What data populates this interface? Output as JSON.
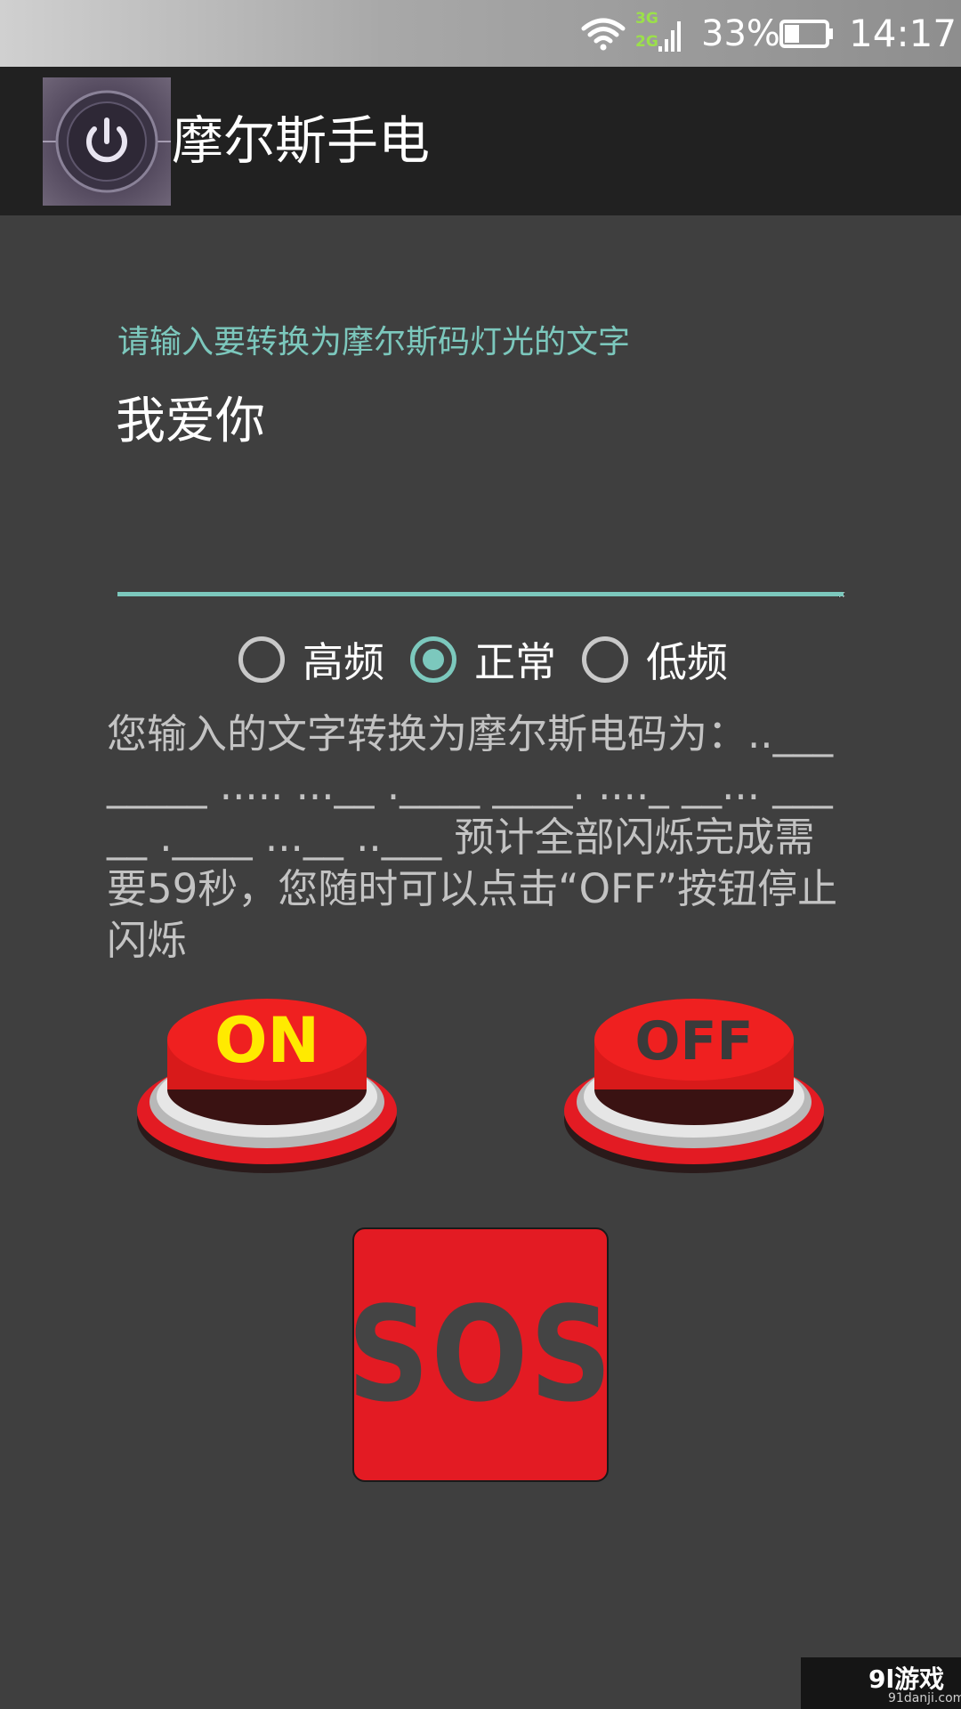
{
  "status_bar": {
    "network_top": "3G",
    "network_bottom": "2G",
    "battery_percent": "33%",
    "time": "14:17",
    "icons": [
      "wifi-icon",
      "signal-icon",
      "battery-icon"
    ]
  },
  "app_bar": {
    "title": "摩尔斯手电",
    "icon": "power-icon"
  },
  "input": {
    "hint": "请输入要转换为摩尔斯码灯光的文字",
    "value": "我爱你"
  },
  "frequency": {
    "options": [
      "高频",
      "正常",
      "低频"
    ],
    "selected": "正常"
  },
  "result_text": "您输入的文字转换为摩尔斯电码为：..___ _____ ..... ...__   .____ ____. ...._ __...   _____ .____ ...__ ..___   预计全部闪烁完成需要59秒，您随时可以点击“OFF”按钮停止闪烁",
  "buttons": {
    "on_label": "ON",
    "off_label": "OFF",
    "sos_label": "SOS"
  },
  "watermark": {
    "main": "9l游戏",
    "sub": "91danji.com"
  },
  "colors": {
    "accent": "#7cc8bd",
    "background": "#3f3f3f",
    "app_bar": "#212121",
    "button_red": "#e31b23",
    "on_text": "#ffea00"
  }
}
